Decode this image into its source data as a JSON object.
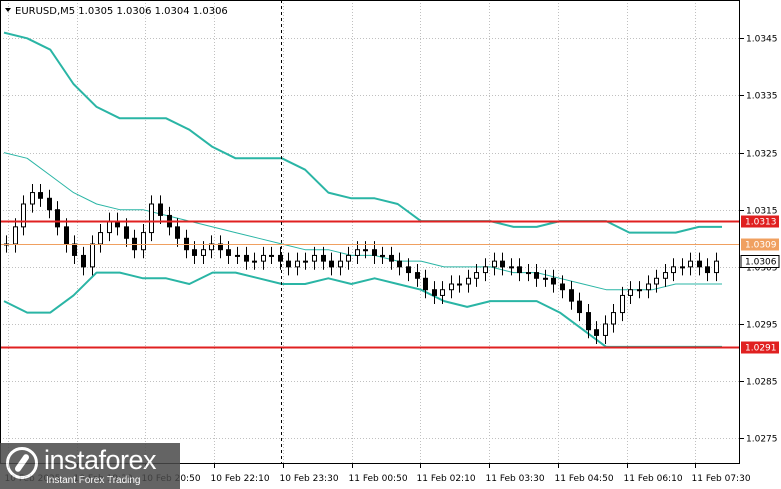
{
  "header": {
    "title": "EURUSD,M5  1.0305 1.0306 1.0304 1.0306"
  },
  "colors": {
    "background": "#ffffff",
    "grid": "#c0c0c0",
    "candles": "#000000",
    "bollinger": "#2ab5a5",
    "ma": "#2ab5a5",
    "level": "#e02020",
    "level_light": "#f0a060",
    "price_tag": "#000000"
  },
  "chart_data": {
    "type": "line",
    "symbol": "EURUSD",
    "timeframe": "M5",
    "ohlc_header": {
      "open": 1.0305,
      "high": 1.0306,
      "low": 1.0304,
      "close": 1.0306
    },
    "y_ticks": [
      "1.0345",
      "1.0335",
      "1.0325",
      "1.0315",
      "1.0305",
      "1.0295",
      "1.0285",
      "1.0275"
    ],
    "ylim": [
      1.02705,
      1.03517
    ],
    "x_ticks": [
      "10 Feb 2025",
      "10 Feb 19:30",
      "10 Feb 20:50",
      "10 Feb 22:10",
      "10 Feb 23:30",
      "11 Feb 00:50",
      "11 Feb 02:10",
      "11 Feb 03:30",
      "11 Feb 04:50",
      "11 Feb 06:10",
      "11 Feb 07:30"
    ],
    "vertical_marker_index": 4,
    "horizontal_levels": [
      {
        "value": 1.0313,
        "label": "1.0313",
        "style": "strong"
      },
      {
        "value": 1.0309,
        "label": "1.0309",
        "style": "light"
      },
      {
        "value": 1.0291,
        "label": "1.0291",
        "style": "strong"
      }
    ],
    "current_price": {
      "value": 1.0306,
      "label": "1.0306"
    },
    "close_series": [
      1.0309,
      1.0312,
      1.0316,
      1.0318,
      1.0317,
      1.0315,
      1.0312,
      1.0309,
      1.0307,
      1.0305,
      1.0309,
      1.0311,
      1.0313,
      1.0312,
      1.031,
      1.0308,
      1.0311,
      1.0316,
      1.0314,
      1.0312,
      1.031,
      1.0308,
      1.0307,
      1.0308,
      1.0309,
      1.0308,
      1.0307,
      1.0307,
      1.0306,
      1.0306,
      1.0307,
      1.0307,
      1.0306,
      1.0305,
      1.0306,
      1.0306,
      1.0307,
      1.0306,
      1.0305,
      1.0306,
      1.0307,
      1.0308,
      1.0308,
      1.0307,
      1.0307,
      1.0306,
      1.0305,
      1.0304,
      1.0303,
      1.0301,
      1.03,
      1.0301,
      1.0302,
      1.0302,
      1.0303,
      1.0304,
      1.0305,
      1.0306,
      1.0305,
      1.0305,
      1.0304,
      1.0304,
      1.0303,
      1.0303,
      1.0302,
      1.0301,
      1.0299,
      1.0297,
      1.0294,
      1.0293,
      1.0295,
      1.0297,
      1.03,
      1.0301,
      1.0301,
      1.0302,
      1.0303,
      1.0304,
      1.0305,
      1.0305,
      1.0306,
      1.0305,
      1.0304,
      1.0306
    ],
    "bollinger_upper": [
      1.0346,
      1.0345,
      1.0343,
      1.0337,
      1.0333,
      1.0331,
      1.0331,
      1.0331,
      1.0329,
      1.0326,
      1.0324,
      1.0324,
      1.0324,
      1.0322,
      1.0318,
      1.0317,
      1.0317,
      1.0316,
      1.0313,
      1.0313,
      1.0313,
      1.0313,
      1.0312,
      1.0312,
      1.0313,
      1.0313,
      1.0313,
      1.0311,
      1.0311,
      1.0311,
      1.0312,
      1.0312
    ],
    "bollinger_middle": [
      1.0325,
      1.0324,
      1.0321,
      1.0318,
      1.0316,
      1.0315,
      1.0315,
      1.0314,
      1.0313,
      1.0312,
      1.0311,
      1.031,
      1.0309,
      1.0308,
      1.0308,
      1.0307,
      1.0307,
      1.0306,
      1.0306,
      1.0305,
      1.0305,
      1.0305,
      1.0304,
      1.0304,
      1.0303,
      1.0302,
      1.0301,
      1.0301,
      1.0301,
      1.0302,
      1.0302,
      1.0302
    ],
    "bollinger_lower": [
      1.0299,
      1.0297,
      1.0297,
      1.03,
      1.0304,
      1.0304,
      1.0303,
      1.0303,
      1.0302,
      1.0304,
      1.0304,
      1.0303,
      1.0302,
      1.0302,
      1.0303,
      1.0302,
      1.0303,
      1.0302,
      1.0301,
      1.0299,
      1.0298,
      1.0299,
      1.0299,
      1.0299,
      1.0297,
      1.0294,
      1.0291,
      1.0291,
      1.0291,
      1.0291,
      1.0291,
      1.0291
    ]
  },
  "watermark": {
    "brand": "instaforex",
    "tagline": "Instant Forex Trading"
  }
}
